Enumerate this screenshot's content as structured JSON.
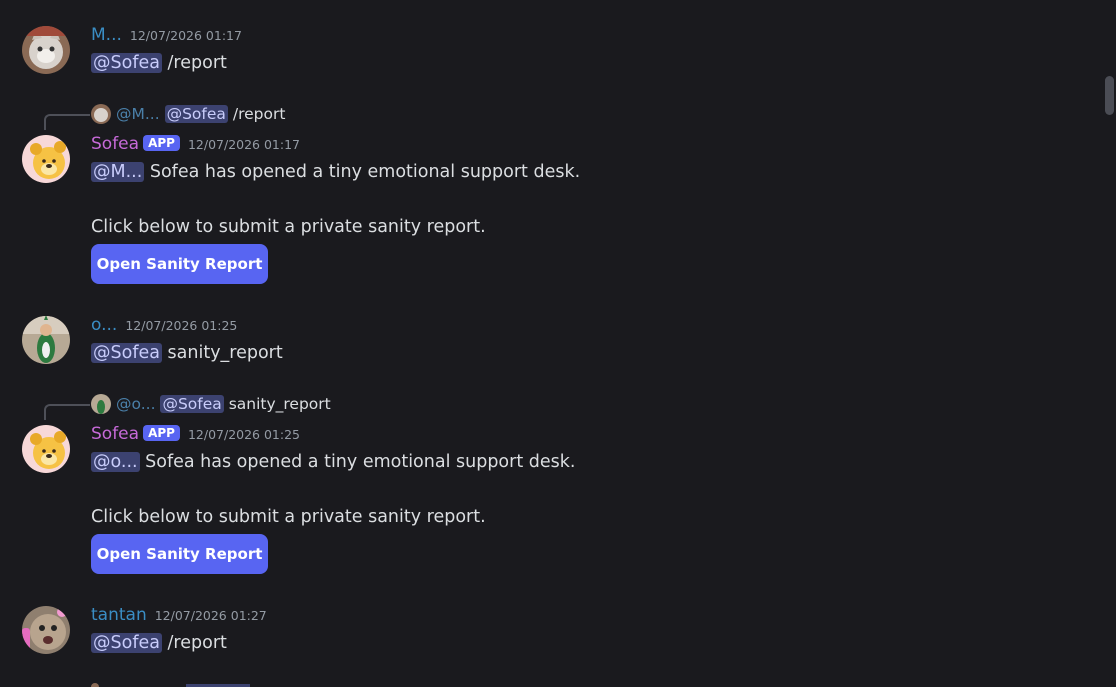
{
  "messages": [
    {
      "author": "M...",
      "author_color": "#3a9bd9",
      "timestamp": "12/07/2026 01:17",
      "mention": "@Sofea",
      "text": " /report"
    },
    {
      "reply": {
        "author": "@M...",
        "mention": "@Sofea",
        "text": " /report"
      },
      "author": "Sofea",
      "author_color": "#c66ad8",
      "badge": "APP",
      "timestamp": "12/07/2026 01:17",
      "mention": "@M...",
      "text": " Sofea has opened a tiny emotional support desk.",
      "line2": "Click below to submit a private sanity report.",
      "button": "Open Sanity Report"
    },
    {
      "author": "o...",
      "author_color": "#3a9bd9",
      "timestamp": "12/07/2026 01:25",
      "mention": "@Sofea",
      "text": " sanity_report"
    },
    {
      "reply": {
        "author": "@o...",
        "mention": "@Sofea",
        "text": " sanity_report"
      },
      "author": "Sofea",
      "author_color": "#c66ad8",
      "badge": "APP",
      "timestamp": "12/07/2026 01:25",
      "mention": "@o...",
      "text": " Sofea has opened a tiny emotional support desk.",
      "line2": "Click below to submit a private sanity report.",
      "button": "Open Sanity Report"
    },
    {
      "author": "tantan",
      "author_color": "#3a9bd9",
      "timestamp": "12/07/2026 01:27",
      "mention": "@Sofea",
      "text": " /report"
    }
  ],
  "colors": {
    "background": "#1a1a1e",
    "accent": "#5865f2",
    "mention_bg": "#3c4270"
  },
  "icons": [
    "cat-avatar",
    "pooh-avatar",
    "dino-costume-avatar",
    "tantan-cat-avatar",
    "scrollbar-thumb"
  ]
}
